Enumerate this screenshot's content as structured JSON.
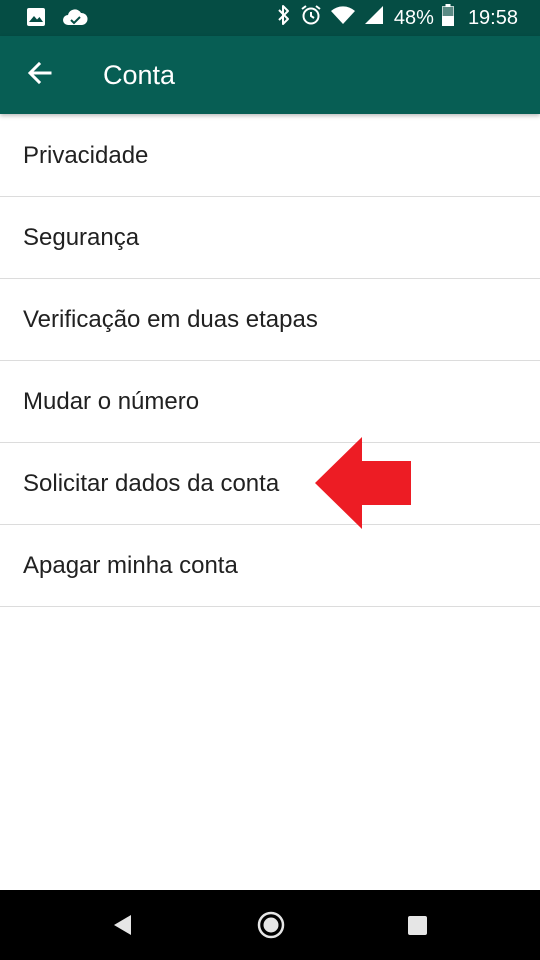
{
  "status_bar": {
    "battery_percent": "48%",
    "time": "19:58",
    "icons": [
      "image-icon",
      "cloud-icon",
      "bluetooth-icon",
      "alarm-icon",
      "wifi-icon",
      "signal-icon",
      "battery-icon"
    ]
  },
  "app_bar": {
    "title": "Conta",
    "back_icon": "arrow-left-icon"
  },
  "menu": {
    "items": [
      {
        "label": "Privacidade"
      },
      {
        "label": "Segurança"
      },
      {
        "label": "Verificação em duas etapas"
      },
      {
        "label": "Mudar o número"
      },
      {
        "label": "Solicitar dados da conta"
      },
      {
        "label": "Apagar minha conta"
      }
    ]
  },
  "annotation": {
    "arrow_color": "#ed1c24",
    "icon": "arrow-left-icon"
  },
  "nav_bar": {
    "icons": [
      "nav-back-icon",
      "nav-home-icon",
      "nav-recents-icon"
    ]
  },
  "colors": {
    "status_bar": "#054d44",
    "app_bar": "#075e54",
    "text": "#212121",
    "divider": "#dcdcdc"
  }
}
